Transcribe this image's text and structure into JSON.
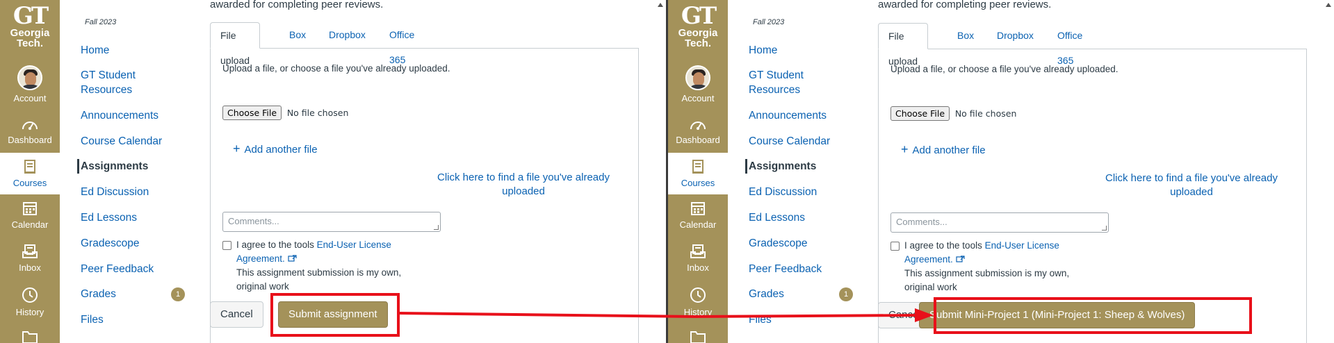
{
  "nav": {
    "logo_top": "GT",
    "logo_line1": "Georgia",
    "logo_line2": "Tech.",
    "items": [
      {
        "label": "Account",
        "icon": "avatar"
      },
      {
        "label": "Dashboard",
        "icon": "dashboard-icon"
      },
      {
        "label": "Courses",
        "icon": "courses-icon",
        "active": true
      },
      {
        "label": "Calendar",
        "icon": "calendar-icon"
      },
      {
        "label": "Inbox",
        "icon": "inbox-icon"
      },
      {
        "label": "History",
        "icon": "history-icon"
      }
    ]
  },
  "course": {
    "term": "Fall 2023",
    "items": [
      {
        "label": "Home"
      },
      {
        "label": "GT Student Resources"
      },
      {
        "label": "Announcements"
      },
      {
        "label": "Course Calendar"
      },
      {
        "label": "Assignments",
        "active": true
      },
      {
        "label": "Ed Discussion"
      },
      {
        "label": "Ed Lessons"
      },
      {
        "label": "Gradescope"
      },
      {
        "label": "Peer Feedback"
      },
      {
        "label": "Grades",
        "badge": "1"
      },
      {
        "label": "Files"
      }
    ]
  },
  "submission": {
    "intro": "awarded for completing peer reviews.",
    "tabs": [
      "File upload",
      "Box",
      "Dropbox",
      "Office 365"
    ],
    "instructions": "Upload a file, or choose a file you've already uploaded.",
    "choose_file": "Choose File",
    "no_file": "No file chosen",
    "add_file": "Add another file",
    "find_link": "Click here to find a file you've already uploaded",
    "comments_placeholder": "Comments...",
    "agree_prefix": "I agree to the tools",
    "agree_link": "End-User License Agreement.",
    "agree_suffix": "This assignment submission is my own, original work",
    "cancel": "Cancel"
  },
  "left_submit": "Submit assignment",
  "right_submit": "Submit Mini-Project 1 (Mini-Project 1: Sheep & Wolves)",
  "colors": {
    "gt_gold": "#a4925a",
    "link": "#0b62b2",
    "annotation": "#e8101a"
  }
}
